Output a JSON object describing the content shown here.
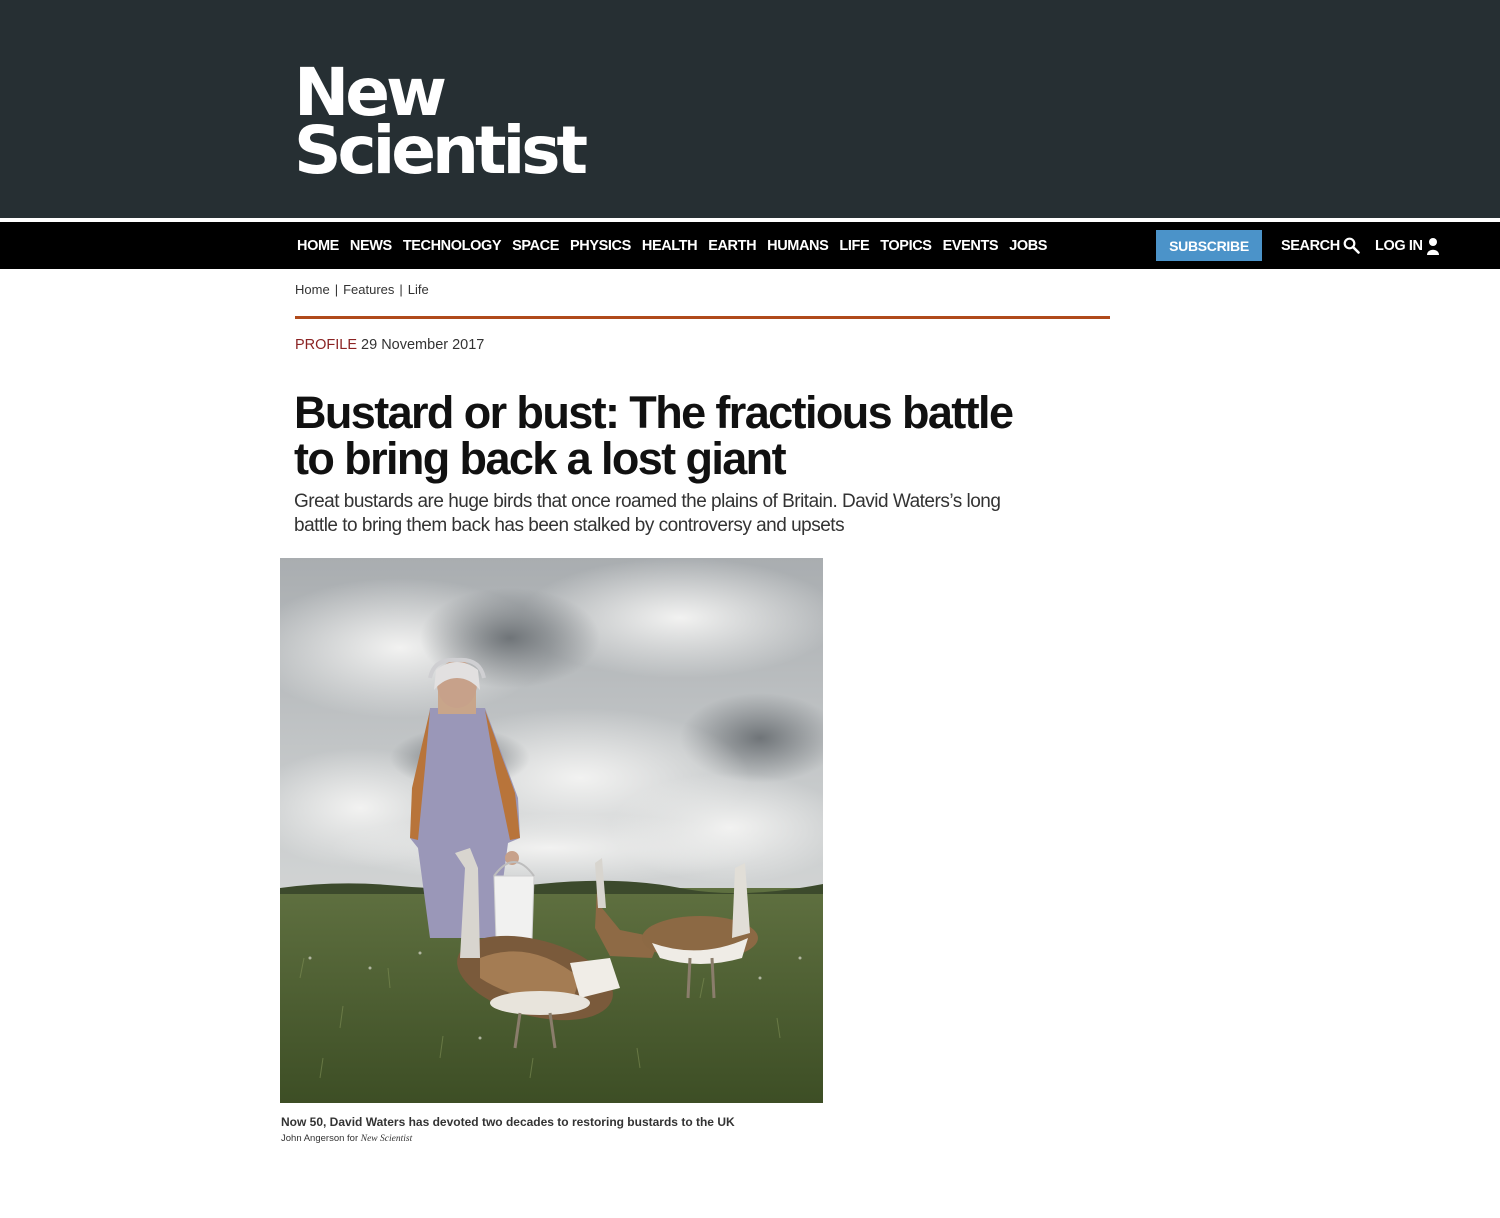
{
  "header": {
    "logo_line1": "New",
    "logo_line2": "Scientist",
    "background": "#262f33"
  },
  "nav": {
    "items": [
      "HOME",
      "NEWS",
      "TECHNOLOGY",
      "SPACE",
      "PHYSICS",
      "HEALTH",
      "EARTH",
      "HUMANS",
      "LIFE",
      "TOPICS",
      "EVENTS",
      "JOBS"
    ],
    "subscribe_label": "SUBSCRIBE",
    "subscribe_color": "#4b93c9",
    "search_label": "SEARCH",
    "login_label": "LOG IN"
  },
  "breadcrumb": [
    "Home",
    "Features",
    "Life"
  ],
  "article": {
    "kicker": "PROFILE",
    "date": "29 November 2017",
    "headline": "Bustard or bust: The fractious battle to bring back a lost giant",
    "standfirst": "Great bustards are huge birds that once roamed the plains of Britain. David Waters’s long battle to bring them back has been stalked by controversy and upsets",
    "caption": "Now 50, David Waters has devoted two decades to restoring bustards to the UK",
    "credit_prefix": "John Angerson for",
    "credit_publication": "New Scientist",
    "accent_rule_color": "#b04a1b",
    "kicker_color": "#8b2323"
  }
}
